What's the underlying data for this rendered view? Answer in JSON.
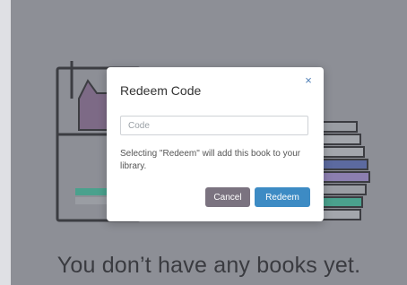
{
  "empty_state": {
    "message": "You don’t have any books yet."
  },
  "modal": {
    "title": "Redeem Code",
    "close_label": "×",
    "code_input": {
      "placeholder": "Code",
      "value": ""
    },
    "description": "Selecting \"Redeem\" will add this book to your library.",
    "cancel_label": "Cancel",
    "redeem_label": "Redeem"
  },
  "colors": {
    "panel_bg": "#8d8f96",
    "redeem_button": "#3d8bc4",
    "cancel_button": "#7b7380",
    "close_icon": "#4f7fb6"
  }
}
